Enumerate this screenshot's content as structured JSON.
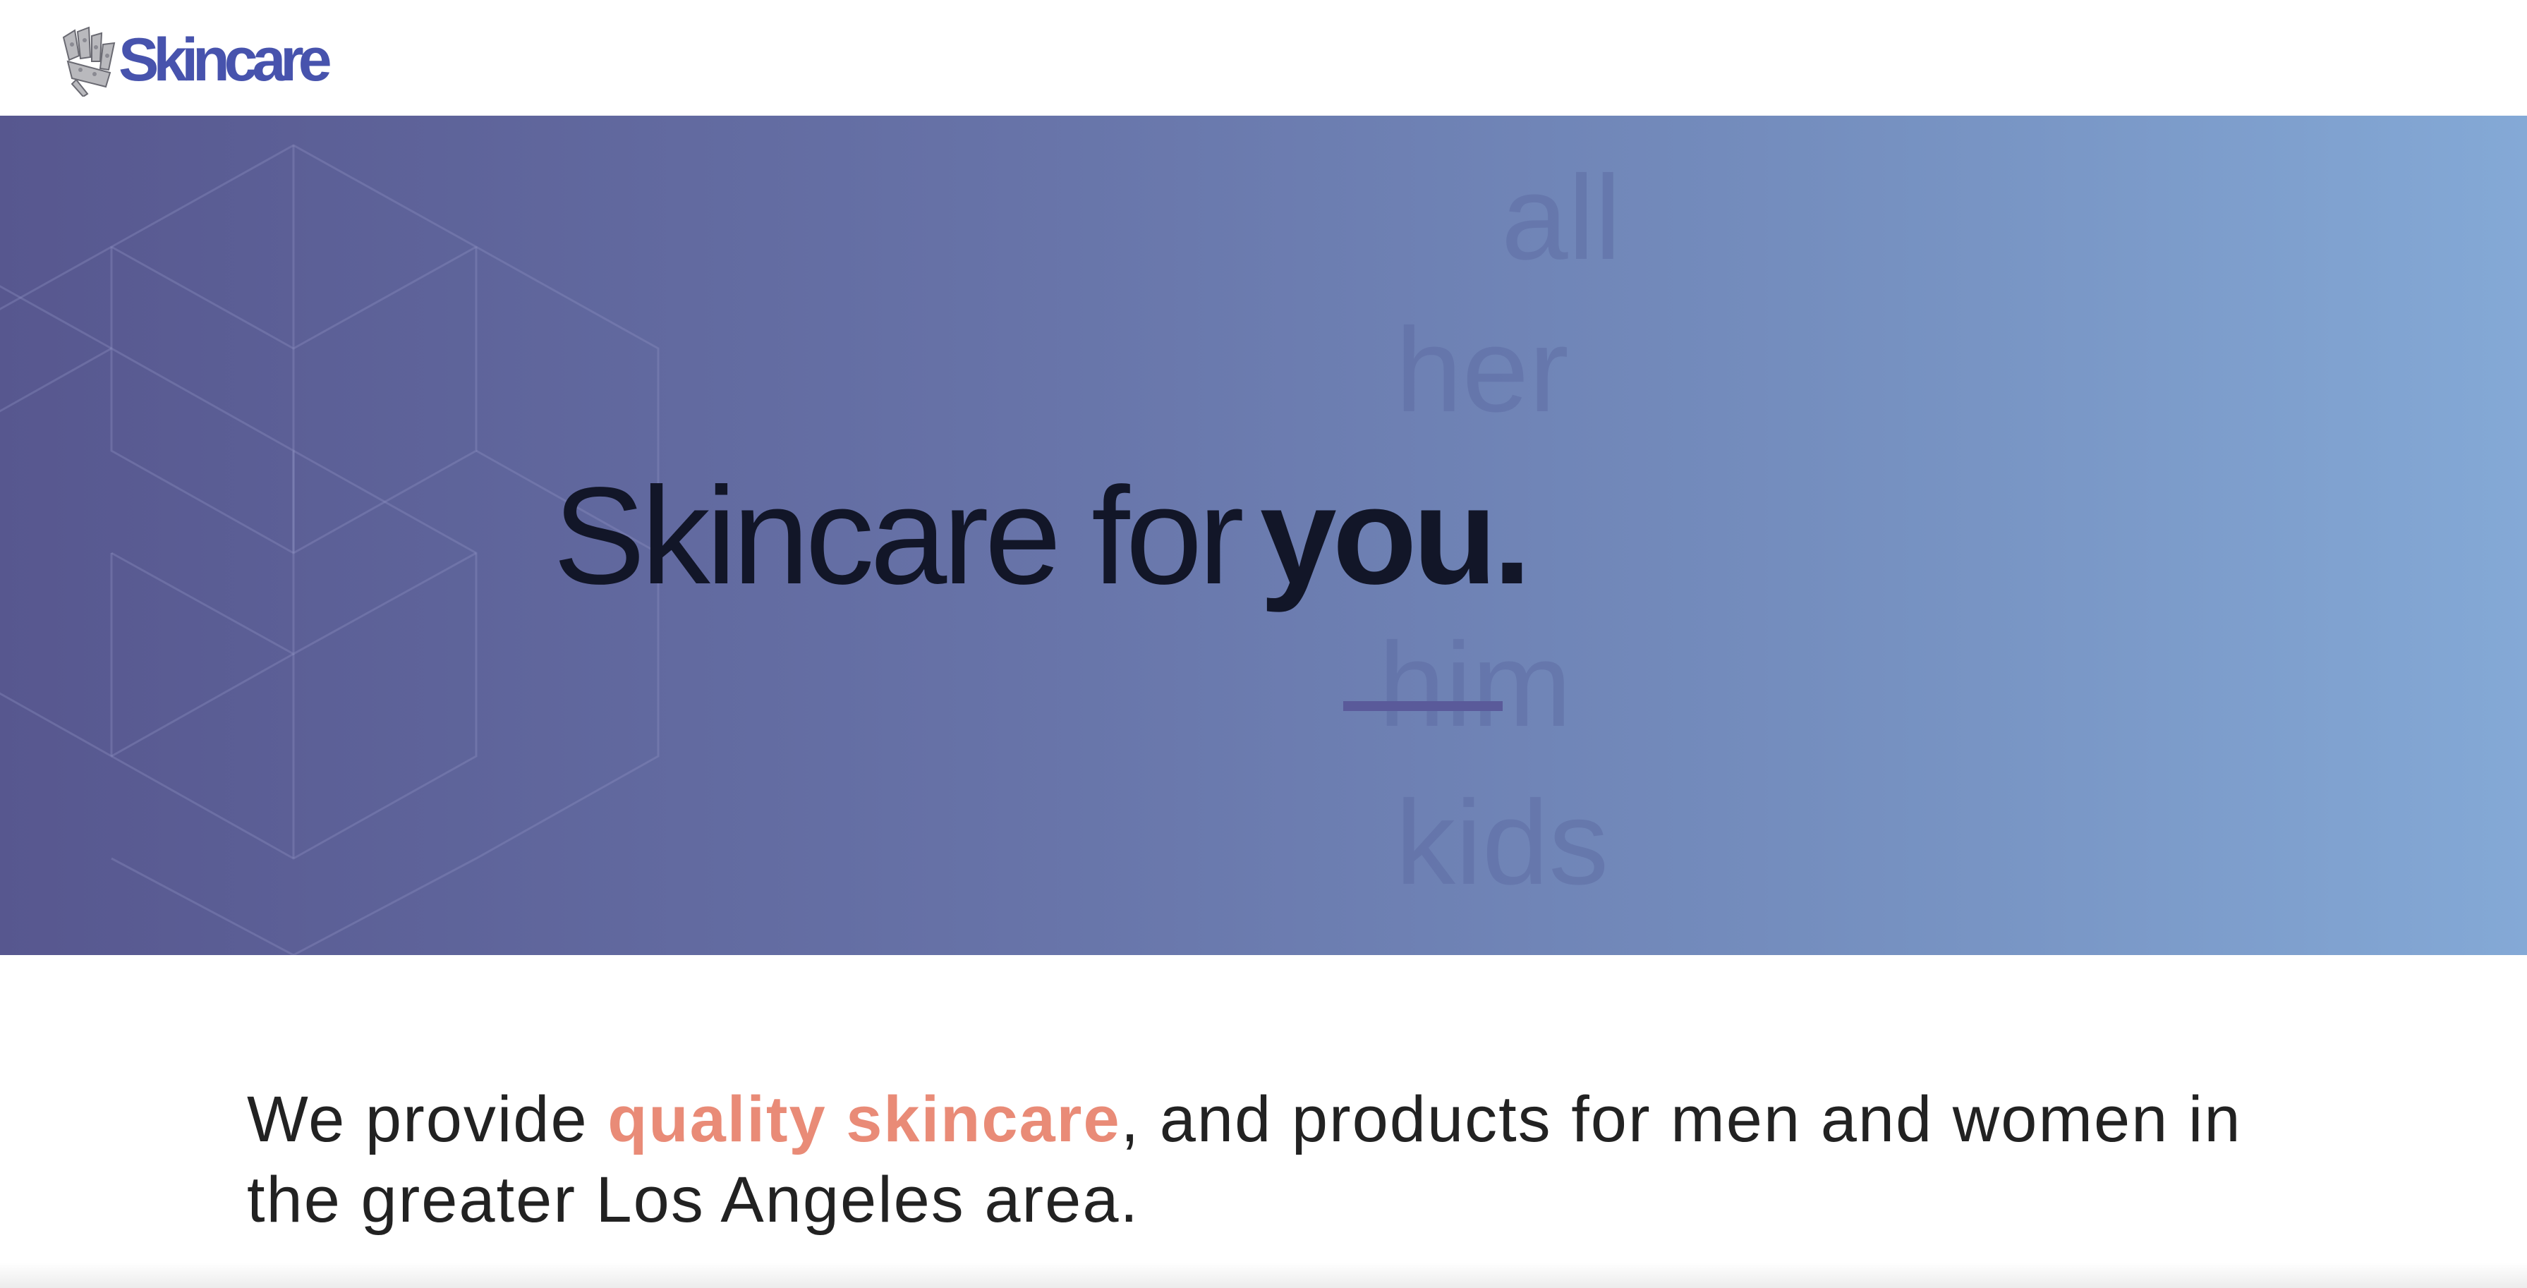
{
  "header": {
    "logo_text": "Skincare",
    "logo_icon": "crown-icon",
    "brand_color": "#4753ad"
  },
  "hero": {
    "headline_plain": "Skincare for",
    "headline_emphasis": "you",
    "headline_period": ".",
    "rotating_words": [
      "all",
      "her",
      "him",
      "kids"
    ],
    "gradient_start": "#57578f",
    "gradient_end": "#84a9d6",
    "pattern": "hexagon-cube-pattern"
  },
  "intro": {
    "before": "We provide ",
    "highlight": "quality skincare",
    "after": ", and products for men and women in the greater Los Angeles area.",
    "highlight_color": "#e98b77"
  }
}
